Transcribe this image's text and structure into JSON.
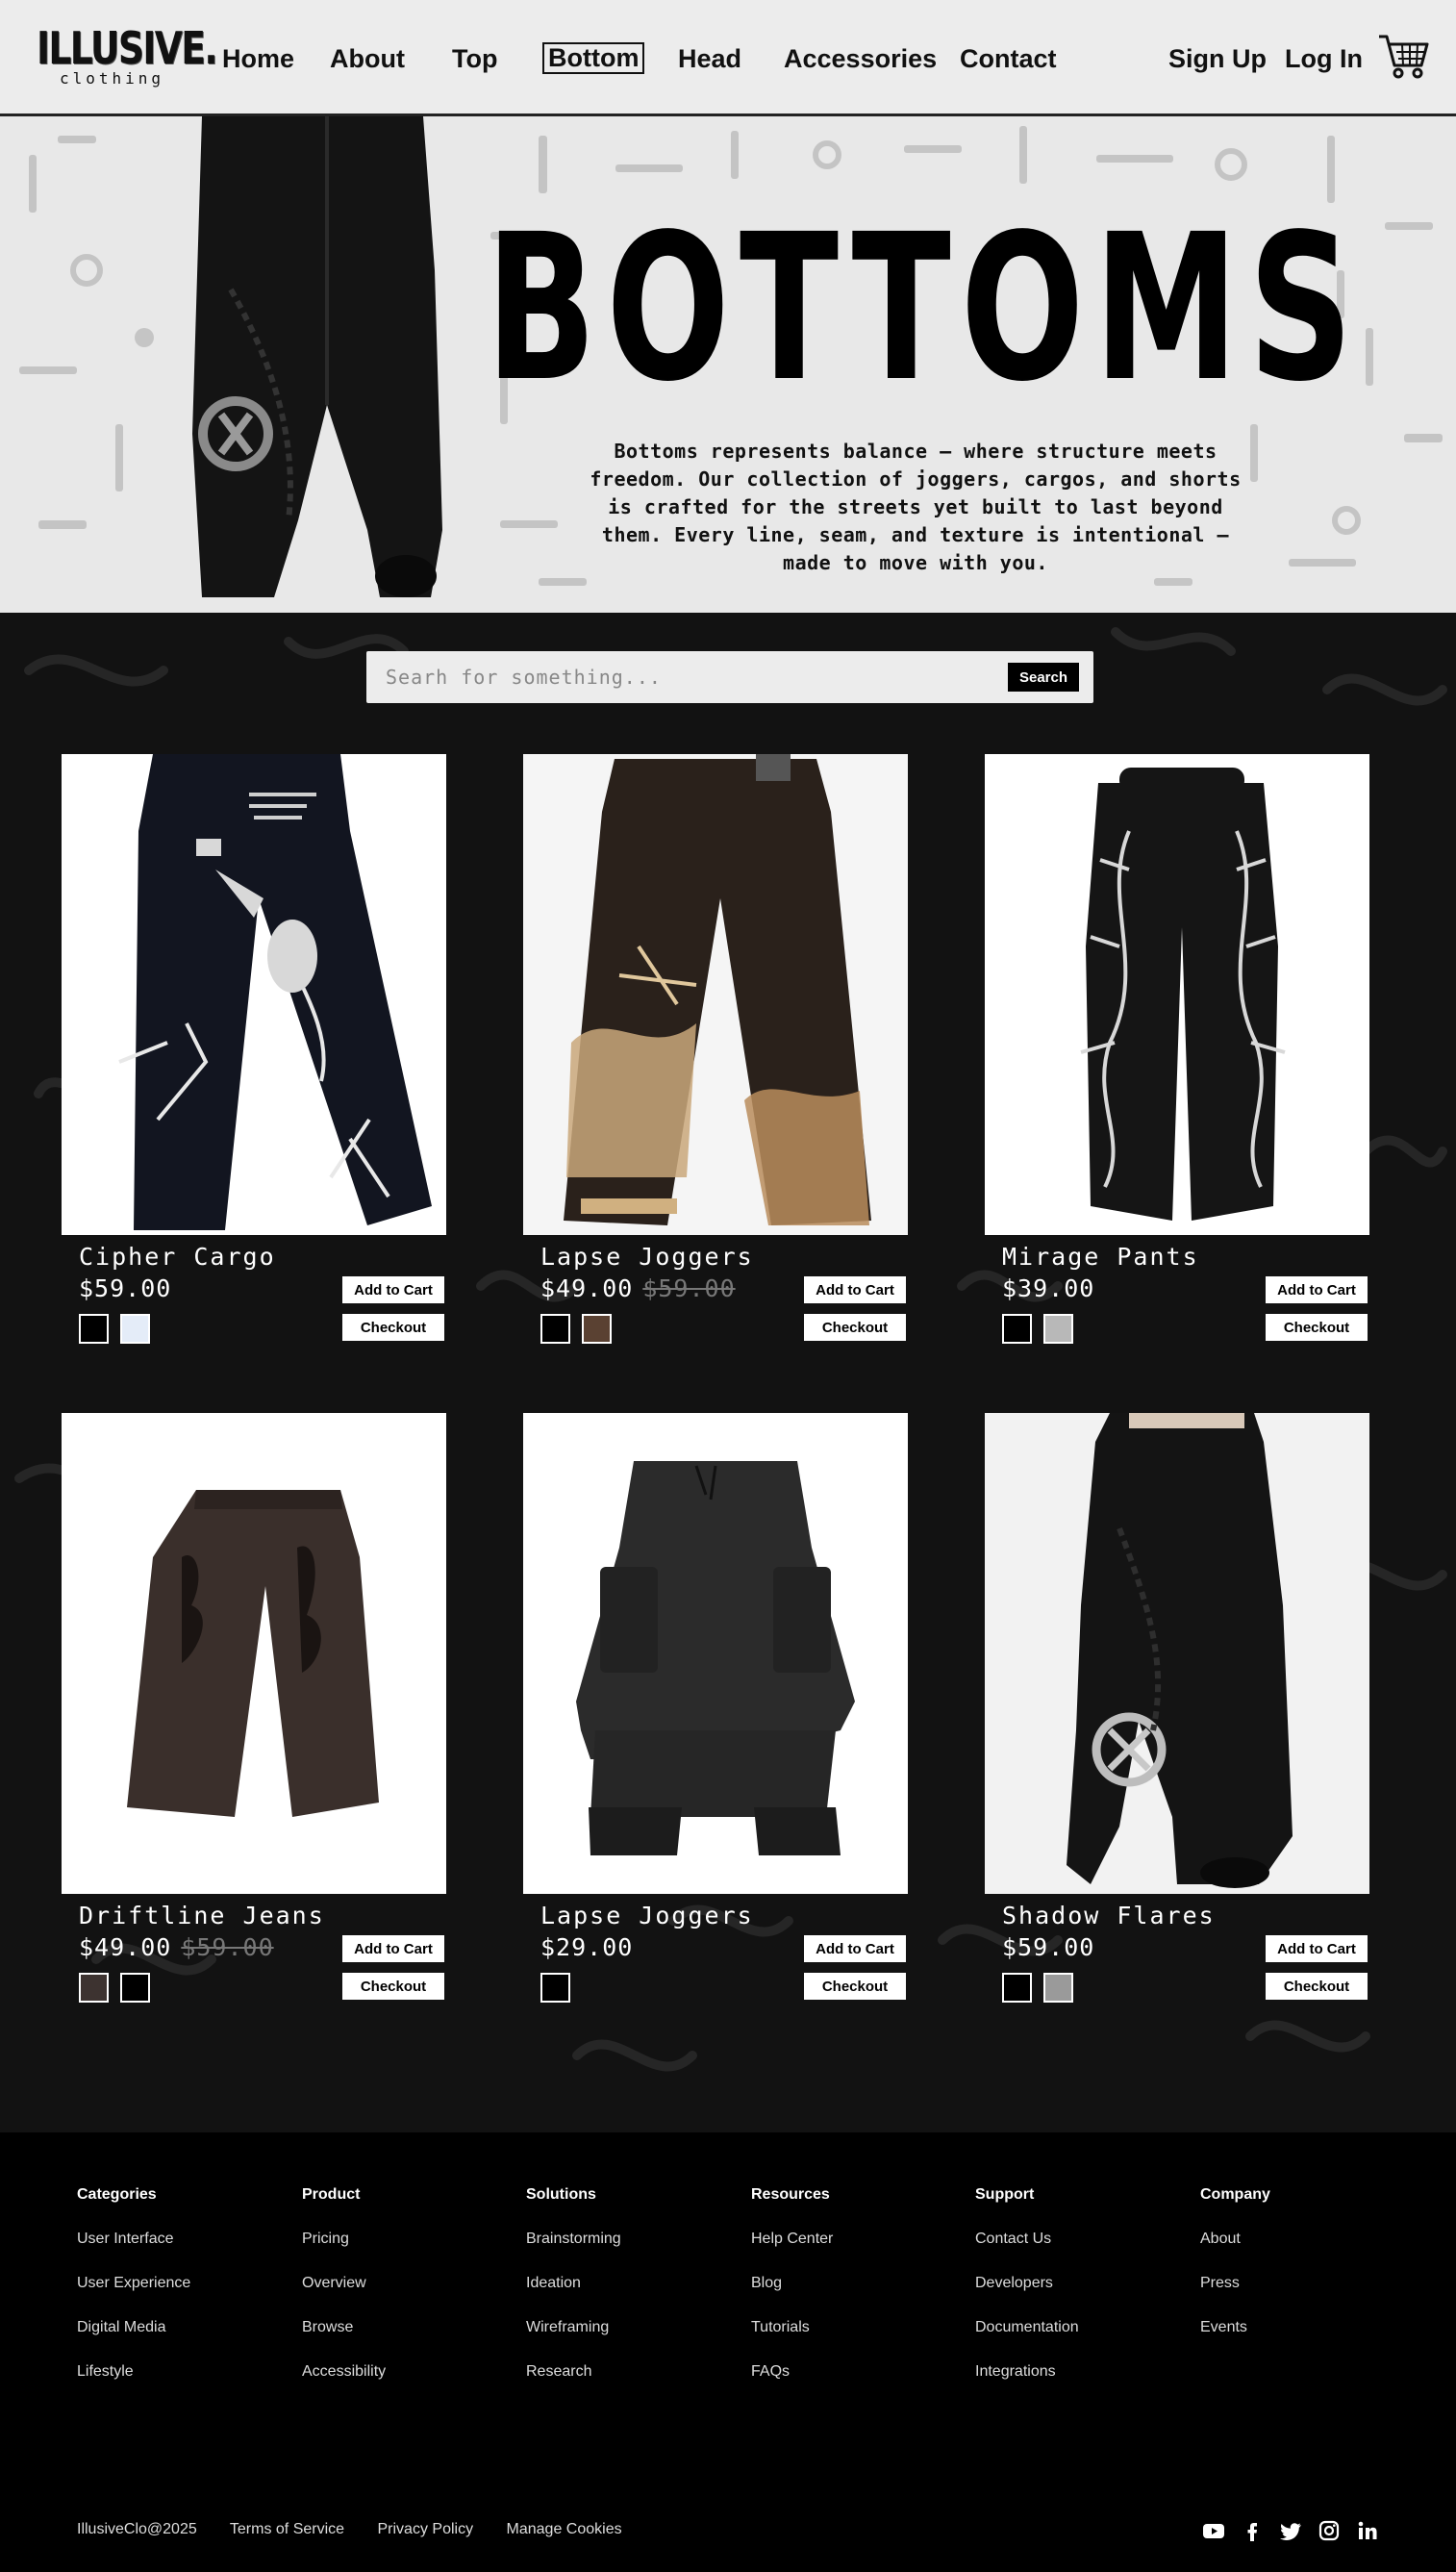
{
  "brand": {
    "name": "ILLUSIVE.",
    "tagline": "clothing"
  },
  "nav": {
    "items": [
      {
        "label": "Home"
      },
      {
        "label": "About"
      },
      {
        "label": "Top"
      },
      {
        "label": "Bottom",
        "active": true
      },
      {
        "label": "Head"
      },
      {
        "label": "Accessories"
      },
      {
        "label": "Contact"
      }
    ],
    "signup": "Sign Up",
    "login": "Log In",
    "cart_icon": "shopping-cart-icon"
  },
  "hero": {
    "title": "BOTTOMS",
    "description": "Bottoms represents balance — where structure meets freedom. Our collection of joggers, cargos, and shorts is crafted for the streets yet built to last beyond them. Every line, seam, and texture is intentional — made to move with you."
  },
  "search": {
    "placeholder": "Searh for something...",
    "button": "Search"
  },
  "buttons": {
    "add_to_cart": "Add to Cart",
    "checkout": "Checkout"
  },
  "products": [
    {
      "name": "Cipher Cargo",
      "price": "$59.00",
      "old_price": "",
      "swatches": [
        "#000000",
        "#e4ecf8"
      ]
    },
    {
      "name": "Lapse Joggers",
      "price": "$49.00",
      "old_price": "$59.00",
      "swatches": [
        "#000000",
        "#5a4132"
      ]
    },
    {
      "name": "Mirage Pants",
      "price": "$39.00",
      "old_price": "",
      "swatches": [
        "#000000",
        "#b8b8b8"
      ]
    },
    {
      "name": "Driftline Jeans",
      "price": "$49.00",
      "old_price": "$59.00",
      "swatches": [
        "#3d3330",
        "#000000"
      ]
    },
    {
      "name": "Lapse Joggers",
      "price": "$29.00",
      "old_price": "",
      "swatches": [
        "#000000"
      ]
    },
    {
      "name": "Shadow Flares",
      "price": "$59.00",
      "old_price": "",
      "swatches": [
        "#000000",
        "#9a9a9a"
      ]
    }
  ],
  "footer": {
    "columns": [
      {
        "title": "Categories",
        "links": [
          "User Interface",
          "User Experience",
          "Digital Media",
          "Lifestyle"
        ]
      },
      {
        "title": "Product",
        "links": [
          "Pricing",
          "Overview",
          "Browse",
          "Accessibility"
        ]
      },
      {
        "title": "Solutions",
        "links": [
          "Brainstorming",
          "Ideation",
          "Wireframing",
          "Research"
        ]
      },
      {
        "title": "Resources",
        "links": [
          "Help Center",
          "Blog",
          "Tutorials",
          "FAQs"
        ]
      },
      {
        "title": "Support",
        "links": [
          "Contact Us",
          "Developers",
          "Documentation",
          "Integrations"
        ]
      },
      {
        "title": "Company",
        "links": [
          "About",
          "Press",
          "Events"
        ]
      }
    ],
    "copyright": "IllusiveClo@2025",
    "legal": [
      "Terms of Service",
      "Privacy Policy",
      "Manage Cookies"
    ],
    "socials": [
      "youtube-icon",
      "facebook-icon",
      "twitter-icon",
      "instagram-icon",
      "linkedin-icon"
    ]
  }
}
